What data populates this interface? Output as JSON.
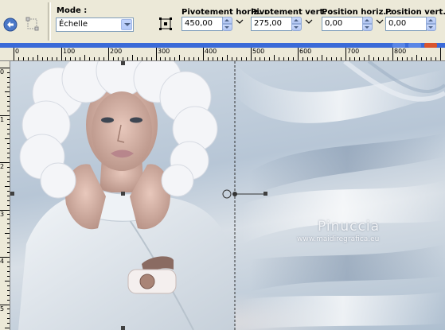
{
  "toolbar": {
    "mode_label": "Mode :",
    "mode_value": "Échelle",
    "pivot_h_label": "Pivotement horiz. :",
    "pivot_h_value": "450,00",
    "pivot_v_label": "Pivotement vert. :",
    "pivot_v_value": "275,00",
    "pos_h_label": "Position horiz. :",
    "pos_h_value": "0,00",
    "pos_v_label": "Position vert. :",
    "pos_v_value": "0,00"
  },
  "ruler": {
    "h_labels": [
      "0",
      "100",
      "200",
      "300",
      "400",
      "500",
      "600",
      "700",
      "800"
    ],
    "v_labels": [
      "0",
      "1",
      "2",
      "3",
      "4",
      "5"
    ]
  },
  "watermark": {
    "title": "Pinuccia",
    "url": "www.maidiregrafica.eu"
  },
  "colors": {
    "toolbar_bg": "#ece9d8",
    "accent_blue": "#3a6ad8",
    "field_border": "#7f9db9"
  }
}
